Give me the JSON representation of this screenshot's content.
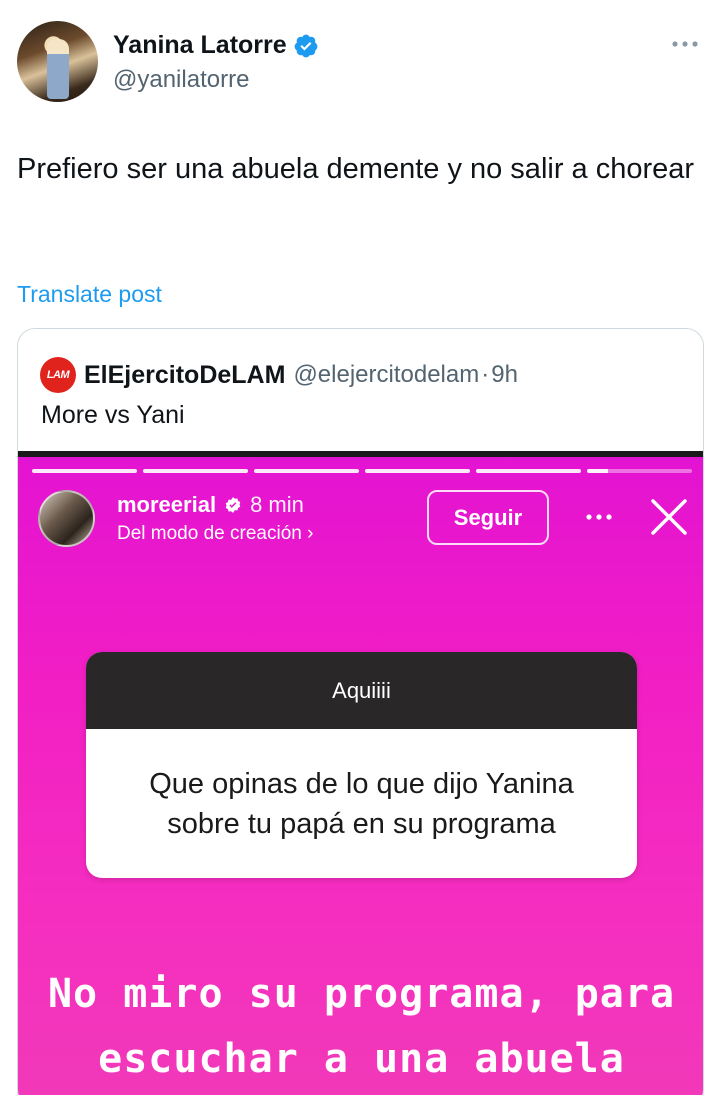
{
  "post": {
    "author_name": "Yanina Latorre",
    "author_handle": "@yanilatorre",
    "text": "Prefiero ser una abuela demente y no salir a chorear",
    "translate_label": "Translate post"
  },
  "quote": {
    "logo_text": "LAM",
    "author_name": "ElEjercitoDeLAM",
    "author_handle": "@elejercitodelam",
    "separator": "·",
    "time": "9h",
    "text": "More vs Yani"
  },
  "story": {
    "progress_segments": 6,
    "username": "moreerial",
    "time": "8 min",
    "subtitle": "Del modo de creación ›",
    "follow_label": "Seguir",
    "question_title": "Aquiiii",
    "question_text": "Que opinas de lo que dijo Yanina sobre tu papá en su programa",
    "answer_text": "No miro su programa, para escuchar a una abuela"
  },
  "icons": {
    "verified": "verified-badge-icon",
    "more": "more-horizontal-icon",
    "close": "close-icon"
  },
  "colors": {
    "x_blue": "#1d9bf0",
    "secondary_text": "#536471",
    "story_bg": "#f21fc4",
    "lam_red": "#e0241d"
  }
}
